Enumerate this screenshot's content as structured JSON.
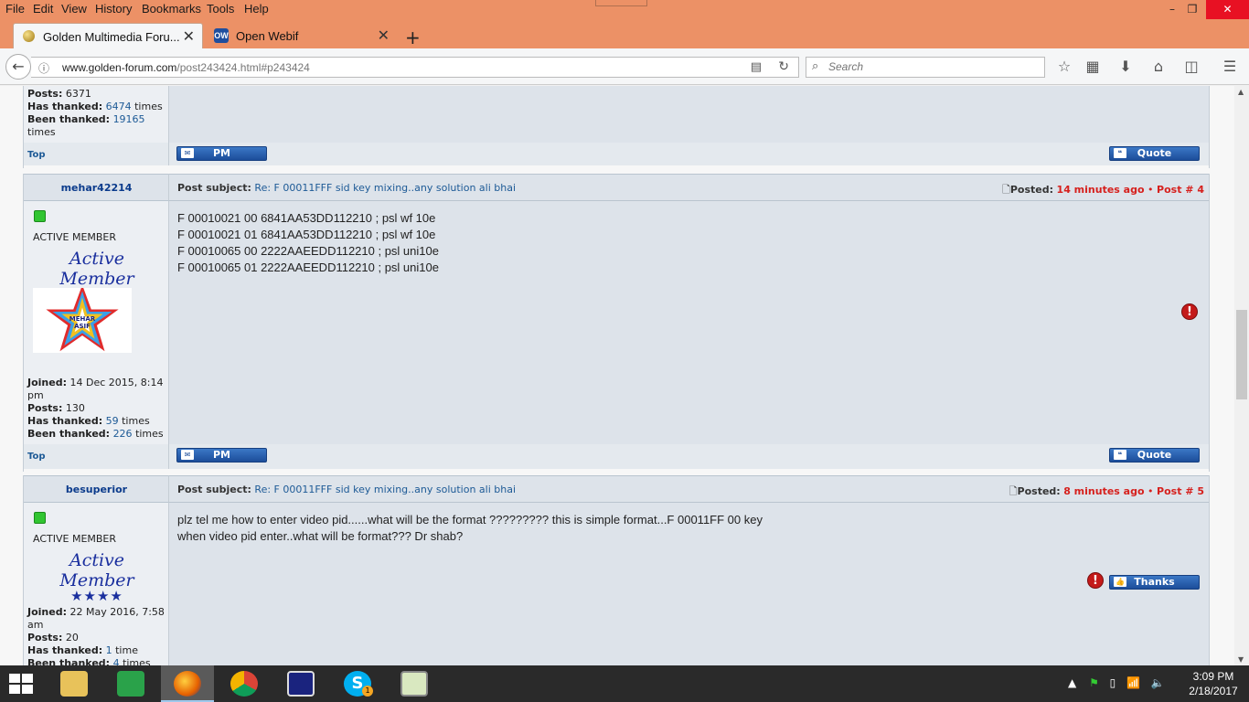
{
  "browser": {
    "menu": [
      "File",
      "Edit",
      "View",
      "History",
      "Bookmarks",
      "Tools",
      "Help"
    ],
    "tabs": [
      {
        "title": "Golden Multimedia Foru...",
        "close": "✕"
      },
      {
        "title": "Open Webif",
        "close": "✕",
        "icon_text": "OW"
      }
    ],
    "new_tab": "+",
    "url_host": "www.golden-forum.com",
    "url_path": "/post243424.html#p243424",
    "search_placeholder": "Search",
    "window_controls": {
      "minimize": "–",
      "maximize": "❐",
      "close": "✕"
    }
  },
  "forum": {
    "prev_post": {
      "posts_label": "Posts:",
      "posts": "6371",
      "has_thanked_label": "Has thanked:",
      "has_thanked": "6474",
      "has_thanked_suffix": "times",
      "been_thanked_label": "Been thanked:",
      "been_thanked": "19165",
      "been_thanked_suffix": "times",
      "top": "Top",
      "pm": "PM",
      "quote": "Quote"
    },
    "posts": [
      {
        "username": "mehar42214",
        "subject_label": "Post subject:",
        "subject": "Re: F 00011FFF sid key mixing..any solution ali bhai",
        "posted_label": "Posted:",
        "posted": "14 minutes ago",
        "post_no": "Post # 4",
        "rank": "ACTIVE MEMBER",
        "rank_title": "Active Member",
        "rank_stars": "★★★★",
        "avatar_text": "MEHAR ASIF",
        "joined_label": "Joined:",
        "joined": "14 Dec 2015, 8:14 pm",
        "posts_label": "Posts:",
        "posts": "130",
        "has_thanked_label": "Has thanked:",
        "has_thanked": "59",
        "has_thanked_suffix": "times",
        "been_thanked_label": "Been thanked:",
        "been_thanked": "226",
        "been_thanked_suffix": "times",
        "text": "F 00010021 00 6841AA53DD112210 ; psl wf 10e\nF 00010021 01 6841AA53DD112210 ; psl wf 10e\nF 00010065 00 2222AAEEDD112210 ; psl uni10e\nF 00010065 01 2222AAEEDD112210 ; psl uni10e",
        "top": "Top",
        "pm": "PM",
        "quote": "Quote"
      },
      {
        "username": "besuperior",
        "subject_label": "Post subject:",
        "subject": "Re: F 00011FFF sid key mixing..any solution ali bhai",
        "posted_label": "Posted:",
        "posted": "8 minutes ago",
        "post_no": "Post # 5",
        "rank": "ACTIVE MEMBER",
        "rank_title": "Active Member",
        "rank_stars": "★★★★",
        "joined_label": "Joined:",
        "joined": "22 May 2016, 7:58 am",
        "posts_label": "Posts:",
        "posts": "20",
        "has_thanked_label": "Has thanked:",
        "has_thanked": "1",
        "has_thanked_suffix": "time",
        "been_thanked_label": "Been thanked:",
        "been_thanked": "4",
        "been_thanked_suffix": "times",
        "text": "plz tel me how to enter video pid......what will be the format ????????? this is simple format...F 00011FF 00 key\nwhen video pid enter..what will be format??? Dr shab?",
        "thanks": "Thanks"
      }
    ]
  },
  "taskbar": {
    "time": "3:09 PM",
    "date": "2/18/2017",
    "skype_badge": "1"
  },
  "colors": {
    "firefox_chrome": "#ec9166",
    "post_bg": "#dde3ea",
    "username": "#0b3b8c",
    "posted_red": "#d6201d",
    "button_blue": "#1c4d9a"
  }
}
